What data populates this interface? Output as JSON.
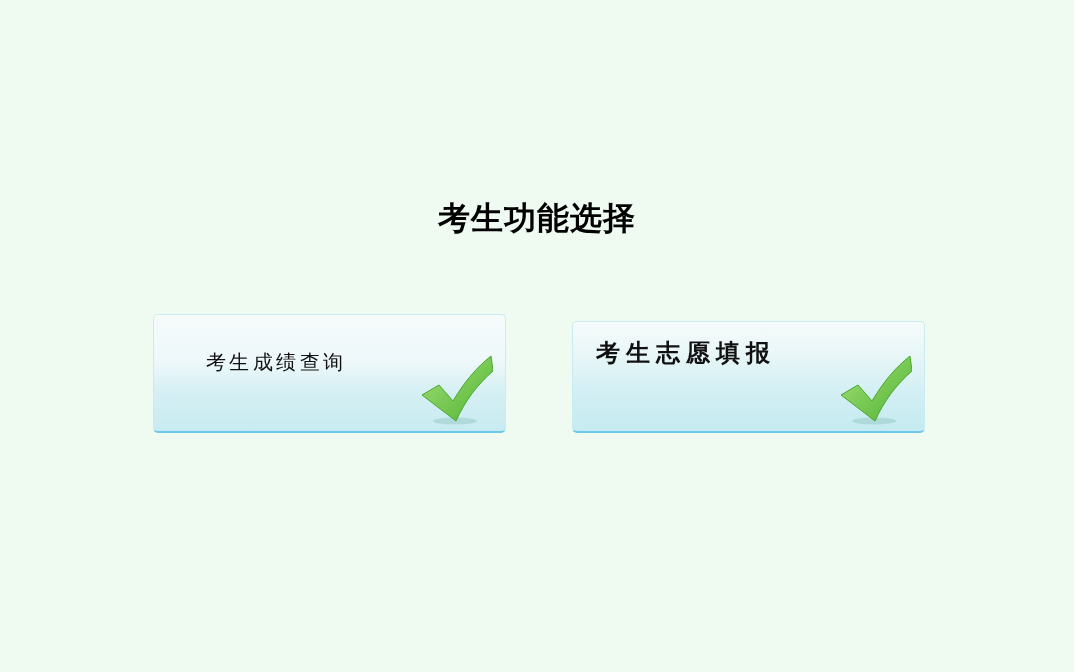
{
  "title": "考生功能选择",
  "options": [
    {
      "label": "考生成绩查询"
    },
    {
      "label": "考生志愿填报"
    }
  ]
}
